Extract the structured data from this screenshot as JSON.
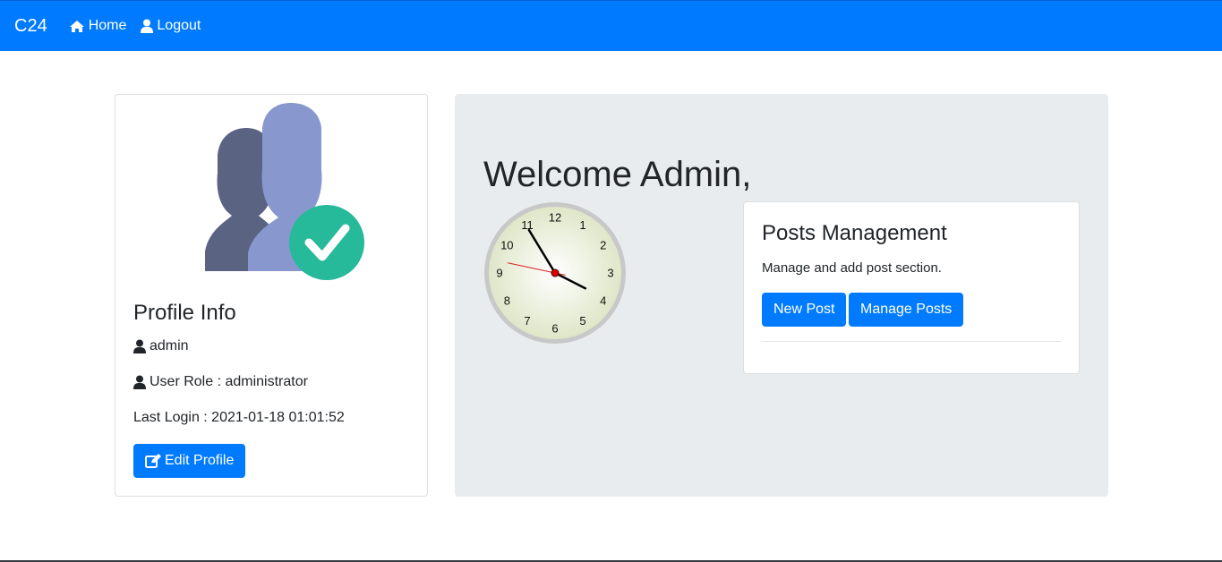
{
  "navbar": {
    "brand": "C24",
    "links": [
      {
        "label": "Home",
        "icon": "home-icon"
      },
      {
        "label": "Logout",
        "icon": "user-icon"
      }
    ],
    "bg_color": "#007bff"
  },
  "profile": {
    "title": "Profile Info",
    "username": "admin",
    "role_text": "User Role : administrator",
    "last_login_text": "Last Login : 2021-01-18 01:01:52",
    "edit_label": "Edit Profile",
    "avatar_icon": "verified-users-icon"
  },
  "welcome": {
    "heading": "Welcome Admin,"
  },
  "clock": {
    "numbers": [
      "12",
      "1",
      "2",
      "3",
      "4",
      "5",
      "6",
      "7",
      "8",
      "9",
      "10",
      "11"
    ],
    "hour": 3,
    "minute": 54,
    "second": 47
  },
  "posts": {
    "title": "Posts Management",
    "description": "Manage and add post section.",
    "new_post_label": "New Post",
    "manage_posts_label": "Manage Posts"
  },
  "colors": {
    "primary": "#007bff",
    "jumbotron": "#e9ecef",
    "check_green": "#26b99a"
  }
}
